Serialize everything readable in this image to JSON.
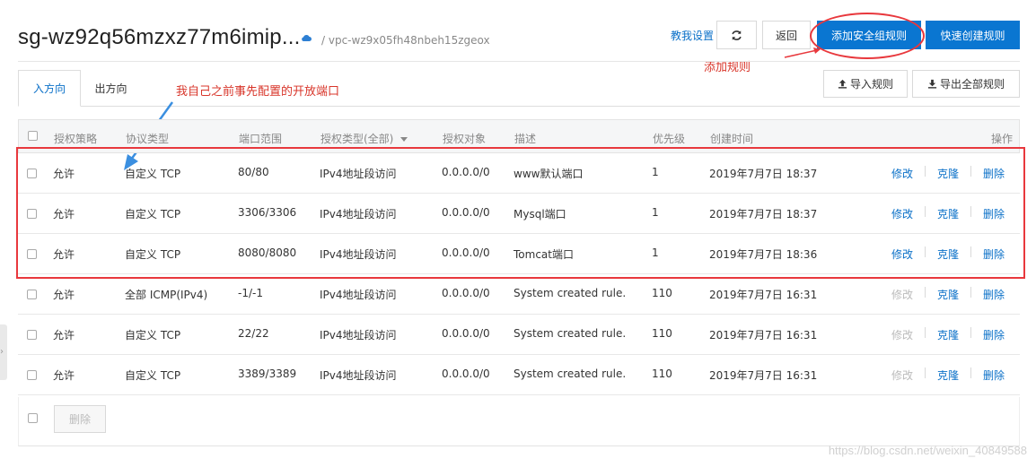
{
  "header": {
    "title": "sg-wz92q56mzxz77m6imip...",
    "vpc": "/ vpc-wz9x05fh48nbeh15zgeox",
    "help_link": "教我设置",
    "back_label": "返回",
    "add_rule_label": "添加安全组规则",
    "quick_create_label": "快速创建规则",
    "import_label": "导入规则",
    "export_label": "导出全部规则"
  },
  "annotations": {
    "add_rule_note": "添加规则",
    "preconfigured_note": "我自己之前事先配置的开放端口"
  },
  "tabs": [
    {
      "label": "入方向",
      "active": true
    },
    {
      "label": "出方向",
      "active": false
    }
  ],
  "table": {
    "columns": [
      "授权策略",
      "协议类型",
      "端口范围",
      "授权类型(全部)",
      "授权对象",
      "描述",
      "优先级",
      "创建时间",
      "操作"
    ],
    "rows": [
      {
        "policy": "允许",
        "protocol": "自定义 TCP",
        "port": "80/80",
        "auth_type": "IPv4地址段访问",
        "object": "0.0.0.0/0",
        "desc": "www默认端口",
        "priority": "1",
        "created": "2019年7月7日 18:37",
        "edit_enabled": true
      },
      {
        "policy": "允许",
        "protocol": "自定义 TCP",
        "port": "3306/3306",
        "auth_type": "IPv4地址段访问",
        "object": "0.0.0.0/0",
        "desc": "Mysql端口",
        "priority": "1",
        "created": "2019年7月7日 18:37",
        "edit_enabled": true
      },
      {
        "policy": "允许",
        "protocol": "自定义 TCP",
        "port": "8080/8080",
        "auth_type": "IPv4地址段访问",
        "object": "0.0.0.0/0",
        "desc": "Tomcat端口",
        "priority": "1",
        "created": "2019年7月7日 18:36",
        "edit_enabled": true
      },
      {
        "policy": "允许",
        "protocol": "全部 ICMP(IPv4)",
        "port": "-1/-1",
        "auth_type": "IPv4地址段访问",
        "object": "0.0.0.0/0",
        "desc": "System created rule.",
        "priority": "110",
        "created": "2019年7月7日 16:31",
        "edit_enabled": false
      },
      {
        "policy": "允许",
        "protocol": "自定义 TCP",
        "port": "22/22",
        "auth_type": "IPv4地址段访问",
        "object": "0.0.0.0/0",
        "desc": "System created rule.",
        "priority": "110",
        "created": "2019年7月7日 16:31",
        "edit_enabled": false
      },
      {
        "policy": "允许",
        "protocol": "自定义 TCP",
        "port": "3389/3389",
        "auth_type": "IPv4地址段访问",
        "object": "0.0.0.0/0",
        "desc": "System created rule.",
        "priority": "110",
        "created": "2019年7月7日 16:31",
        "edit_enabled": false
      }
    ],
    "actions": {
      "edit": "修改",
      "clone": "克隆",
      "delete": "删除"
    },
    "footer_delete": "删除"
  },
  "watermark": "https://blog.csdn.net/weixin_40849588",
  "colors": {
    "primary": "#0a76d1",
    "annotation_red": "#e8383d",
    "link": "#0a70c8"
  }
}
